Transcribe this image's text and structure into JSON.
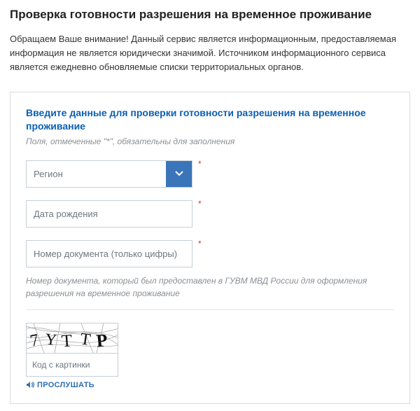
{
  "page": {
    "title": "Проверка готовности разрешения на временное проживание",
    "intro": "Обращаем Ваше внимание! Данный сервис является информационным, предоставляемая информация не является юридически значимой. Источником информационного сервиса является ежедневно обновляемые списки территориальных органов."
  },
  "form": {
    "heading": "Введите данные для проверки готовности разрешения на временное проживание",
    "required_hint": "Поля, отмеченные \"*\", обязательны для заполнения",
    "region_placeholder": "Регион",
    "dob_placeholder": "Дата рождения",
    "docnum_placeholder": "Номер документа (только цифры)",
    "docnum_help": "Номер документа, который был предоставлен в ГУВМ МВД России для оформления разрешения на временное проживание",
    "star": "*"
  },
  "captcha": {
    "input_placeholder": "Код с картинки",
    "listen_label": "ПРОСЛУШАТЬ",
    "text": "7YTTP"
  },
  "colors": {
    "accent": "#0b5fb4",
    "select_btn": "#3a74b9",
    "border": "#c5ced7"
  }
}
